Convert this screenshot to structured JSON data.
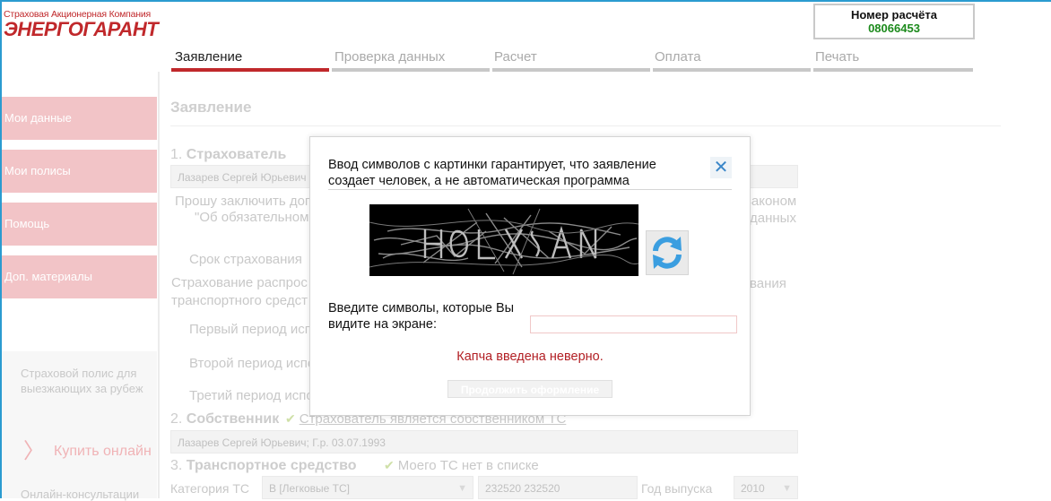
{
  "logo": {
    "company_line": "Страховая Акционерная Компания",
    "brand": "ЭНЕРГОГАРАНТ"
  },
  "calc": {
    "title": "Номер расчёта",
    "number": "08066453"
  },
  "steps": [
    {
      "label": "Заявление",
      "active": true
    },
    {
      "label": "Проверка данных",
      "active": false
    },
    {
      "label": "Расчет",
      "active": false
    },
    {
      "label": "Оплата",
      "active": false
    },
    {
      "label": "Печать",
      "active": false
    }
  ],
  "sidebar": {
    "items": [
      {
        "label": "Мои данные"
      },
      {
        "label": "Мои полисы"
      },
      {
        "label": "Помощь"
      },
      {
        "label": "Доп. материалы"
      }
    ],
    "promo_text": "Страховой полис для выезжающих за рубеж",
    "buy_label": "Купить онлайн",
    "consult_label": "Онлайн-консультации"
  },
  "form": {
    "heading": "Заявление",
    "section1": {
      "num": "1.",
      "title": "Страхователь"
    },
    "insurer_value": "Лазарев Сергей Юрьевич",
    "request_text_left": "Прошу заключить дог",
    "request_text_left2": "\"Об обязательном",
    "request_text_right": "законом",
    "request_text_right2": "данных",
    "term_label": "Срок страхования",
    "usage_text_left": "Страхование распрос",
    "usage_text_left2": "транспортного средст",
    "usage_text_right": "вания",
    "period1": "Первый период исп",
    "period2": "Второй период испо",
    "period3": "Третий период испо",
    "section2": {
      "num": "2.",
      "title": "Собственник"
    },
    "owner_check_label": "Страхователь является собственником ТС",
    "owner_value": "Лазарев Сергей Юрьевич; Г.р. 03.07.1993",
    "section3": {
      "num": "3.",
      "title": "Транспортное средство"
    },
    "vehicle_check_label": "Моего ТС нет в списке",
    "category_label": "Категория ТС",
    "category_value": "В [Легковые ТС]",
    "model_value": "232520 232520",
    "year_label": "Год выпуска",
    "year_value": "2010"
  },
  "modal": {
    "message": "Ввод символов с картинки гарантирует, что заявление создает человек, а не автоматическая программа",
    "close_icon": "close-icon",
    "refresh_icon": "refresh-icon",
    "input_label": "Введите символы, которые Вы видите на экране:",
    "input_value": "",
    "error": "Капча введена неверно.",
    "continue_label": "Продолжить оформление"
  },
  "colors": {
    "brand_red": "#c0282b",
    "sidebar_pink": "#f2c4c7",
    "calc_green": "#1c8a1c",
    "error_red": "#b21f24"
  }
}
